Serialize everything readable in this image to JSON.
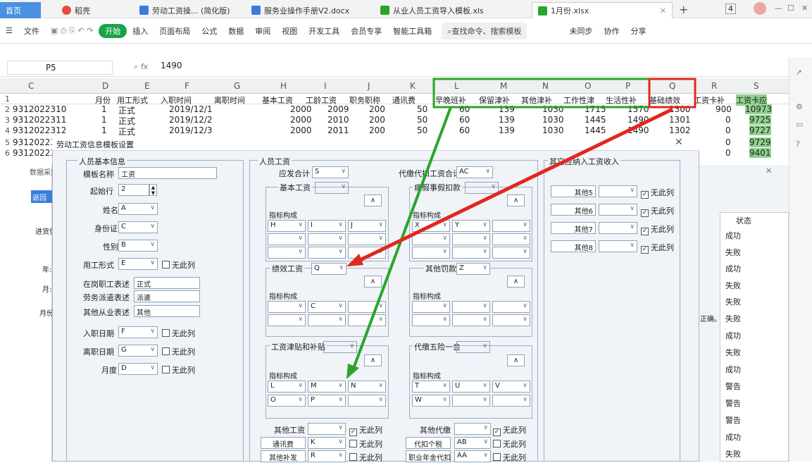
{
  "tabs": [
    {
      "label": "首页",
      "kind": "home"
    },
    {
      "label": "稻壳",
      "icon": "wps-logo-icon"
    },
    {
      "label": "劳动工资操... (简化版)",
      "icon": "doc-icon"
    },
    {
      "label": "服务业操作手册V2.docx",
      "icon": "doc-icon"
    },
    {
      "label": "从业人员工资导入模板.xls",
      "icon": "sheet-icon"
    },
    {
      "label": "1月份.xlsx",
      "icon": "sheet-icon",
      "active": true
    }
  ],
  "window": {
    "page_num": "4",
    "minimize": "—",
    "restore": "☐",
    "close": "✕"
  },
  "menu": {
    "file": "文件",
    "start": "开始",
    "items": [
      "插入",
      "页面布局",
      "公式",
      "数据",
      "审阅",
      "视图",
      "开发工具",
      "会员专享",
      "智能工具箱"
    ],
    "search": "查找命令、搜索模板",
    "right": [
      "未同步",
      "协作",
      "分享"
    ]
  },
  "formula": {
    "cell": "P5",
    "value": "1490"
  },
  "columns": [
    "C",
    "D",
    "E",
    "F",
    "G",
    "H",
    "I",
    "J",
    "K",
    "L",
    "M",
    "N",
    "O",
    "P",
    "Q",
    "R",
    "S"
  ],
  "header_row": [
    "月份",
    "用工形式",
    "入职时间",
    "离职时间",
    "基本工资",
    "工龄工资",
    "职务职称",
    "通讯费",
    "早晚班补",
    "保留津补",
    "其他津补",
    "工作性津",
    "生活性补",
    "基础绩效",
    "工资卡补",
    "工资卡应"
  ],
  "rows": [
    {
      "n": "2",
      "c": "9312022310",
      "d": "1",
      "e": "正式",
      "f": "2019/12/1",
      "h": "2000",
      "i": "2009",
      "j": "200",
      "k": "50",
      "l": "60",
      "m": "139",
      "n2": "1030",
      "o": "1715",
      "p": "1570",
      "q": "1300",
      "r": "900",
      "s": "10973"
    },
    {
      "n": "3",
      "c": "9312022311",
      "d": "1",
      "e": "正式",
      "f": "2019/12/2",
      "h": "2000",
      "i": "2010",
      "j": "200",
      "k": "50",
      "l": "60",
      "m": "139",
      "n2": "1030",
      "o": "1445",
      "p": "1490",
      "q": "1301",
      "r": "0",
      "s": "9725"
    },
    {
      "n": "4",
      "c": "9312022312",
      "d": "1",
      "e": "正式",
      "f": "2019/12/3",
      "h": "2000",
      "i": "2011",
      "j": "200",
      "k": "50",
      "l": "60",
      "m": "139",
      "n2": "1030",
      "o": "1445",
      "p": "1490",
      "q": "1302",
      "r": "0",
      "s": "9727"
    },
    {
      "n": "5",
      "c": "9312022313",
      "r": "0",
      "s": "9729"
    },
    {
      "n": "6",
      "c": "9312022314",
      "r": "0",
      "s": "9401"
    }
  ],
  "dialog": {
    "title": "劳动工资信息模板设置",
    "close": "✕",
    "person_group": "人员基本信息",
    "template_name_label": "模板名称",
    "template_name": "工资",
    "start_row_label": "起始行",
    "start_row": "2",
    "name_label": "姓名",
    "name_col": "A",
    "id_label": "身份证",
    "id_col": "C",
    "gender_label": "性别",
    "gender_col": "B",
    "emp_type_label": "用工形式",
    "emp_type_col": "E",
    "no_col": "无此列",
    "regular_label": "在岗职工表述",
    "regular_val": "正式",
    "dispatch_label": "劳务派遣表述",
    "dispatch_val": "派遣",
    "other_label": "其他从业表述",
    "other_val": "其他",
    "entry_label": "入职日期",
    "entry_col": "F",
    "leave_label": "离职日期",
    "leave_col": "G",
    "month_label": "月度",
    "month_col": "D",
    "wage_group": "人员工资",
    "payable_label": "应发合计",
    "payable_col": "S",
    "basic_label": "基本工资",
    "indicator": "指标构成",
    "basic_cols": [
      "H",
      "I",
      "J"
    ],
    "perf_label": "绩效工资",
    "perf_col": "Q",
    "perf_cols": [
      "C"
    ],
    "allow_label": "工资津贴和补贴",
    "allow_cols": [
      "L",
      "M",
      "N",
      "O",
      "P"
    ],
    "other_wage_label": "其他工资",
    "comm_label": "通讯费",
    "comm_col": "K",
    "other_sub_label": "其他补发",
    "other_sub_col": "R",
    "agent_label": "代缴代扣工资合计",
    "agent_col": "AC",
    "sick_label": "病假事假扣款",
    "sick_cols": [
      "X",
      "Y"
    ],
    "penalty_label": "其他罚款",
    "penalty_col": "Z",
    "ins_label": "代缴五险一金",
    "ins_cols": [
      "T",
      "U",
      "V",
      "W"
    ],
    "other_agent_label": "其他代缴",
    "tax_label": "代扣个税",
    "tax_col": "AB",
    "pension_label": "职业年金代扣",
    "pension_col": "AA",
    "extra_group": "其它应纳入工资收入",
    "extra_items": [
      "其他5",
      "其他6",
      "其他7",
      "其他8"
    ]
  },
  "side": {
    "collect": "数据采集",
    "back": "返回",
    "import": "进货信息",
    "year": "年:",
    "month": "月:",
    "month_col": "月份",
    "status_head": "状态",
    "tip": "正确。",
    "statuses": [
      "成功",
      "失败",
      "成功",
      "失败",
      "失败",
      "失败",
      "成功",
      "失败",
      "成功",
      "警告",
      "警告",
      "警告",
      "成功",
      "失败"
    ]
  },
  "highlight_colors": {
    "green": "#2aa52a",
    "red": "#e0281f"
  }
}
